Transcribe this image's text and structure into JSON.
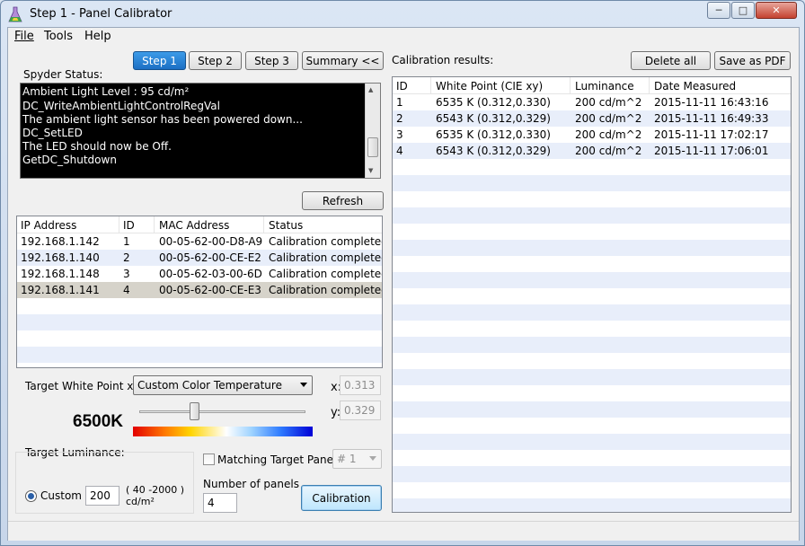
{
  "window": {
    "title": "Step 1 - Panel Calibrator"
  },
  "menu": {
    "file": "File",
    "tools": "Tools",
    "help": "Help"
  },
  "steps": {
    "step1": "Step 1",
    "step2": "Step 2",
    "step3": "Step 3",
    "summary": "Summary <<"
  },
  "spyder": {
    "label": "Spyder Status:",
    "lines": [
      "Ambient Light Level : 95 cd/m²",
      "DC_WriteAmbientLightControlRegVal",
      "The ambient light sensor has been powered down...",
      "DC_SetLED",
      "The LED should now be Off.",
      "GetDC_Shutdown"
    ]
  },
  "refresh_label": "Refresh",
  "devices": {
    "columns": [
      "IP Address",
      "ID",
      "MAC Address",
      "Status"
    ],
    "rows": [
      [
        "192.168.1.142",
        "1",
        "00-05-62-00-D8-A9",
        "Calibration completed"
      ],
      [
        "192.168.1.140",
        "2",
        "00-05-62-00-CE-E2",
        "Calibration completed"
      ],
      [
        "192.168.1.148",
        "3",
        "00-05-62-03-00-6D",
        "Calibration completed"
      ],
      [
        "192.168.1.141",
        "4",
        "00-05-62-00-CE-E3",
        "Calibration completed"
      ]
    ]
  },
  "target_white": {
    "label": "Target White Point xy:",
    "selected": "Custom Color Temperature",
    "x_label": "x:",
    "x_value": "0.313",
    "y_label": "y:",
    "y_value": "0.329",
    "temperature": "6500K",
    "slider_fraction": 0.32
  },
  "target_luminance": {
    "label": "Target Luminance:",
    "custom_label": "Custom",
    "value": "200",
    "range": "( 40 -2000 )",
    "unit": "cd/m²"
  },
  "matching": {
    "label": "Matching Target Panel",
    "selected": "# 1"
  },
  "panels": {
    "label": "Number of panels",
    "value": "4"
  },
  "calibration_label": "Calibration",
  "results": {
    "label": "Calibration results:",
    "delete_label": "Delete all",
    "pdf_label": "Save as PDF",
    "columns": [
      "ID",
      "White Point (CIE xy)",
      "Luminance",
      "Date Measured"
    ],
    "rows": [
      [
        "1",
        "6535 K (0.312,0.330)",
        "200 cd/m^2",
        "2015-11-11 16:43:16"
      ],
      [
        "2",
        "6543 K (0.312,0.329)",
        "200 cd/m^2",
        "2015-11-11 16:49:33"
      ],
      [
        "3",
        "6535 K (0.312,0.330)",
        "200 cd/m^2",
        "2015-11-11 17:02:17"
      ],
      [
        "4",
        "6543 K (0.312,0.329)",
        "200 cd/m^2",
        "2015-11-11 17:06:01"
      ]
    ]
  },
  "colors": {
    "accent": "#1c6fc4",
    "stripe": "#e8eefa",
    "selected_row": "#d6d3ca"
  }
}
